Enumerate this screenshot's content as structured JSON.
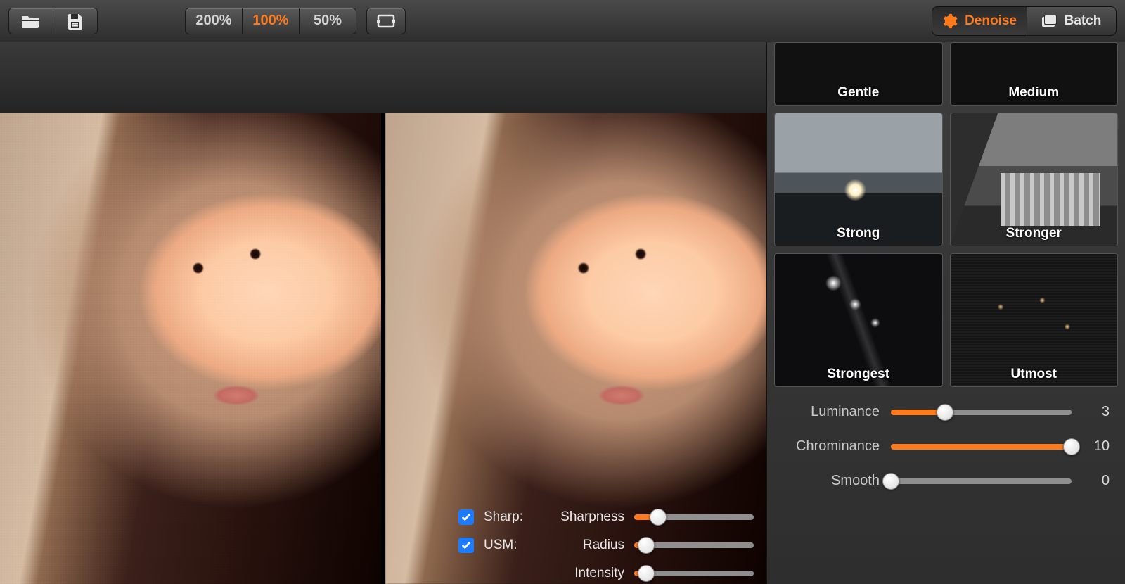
{
  "toolbar": {
    "zoom_options": [
      "200%",
      "100%",
      "50%"
    ],
    "zoom_active_index": 1
  },
  "modes": {
    "denoise_label": "Denoise",
    "batch_label": "Batch",
    "active": "denoise"
  },
  "presets": [
    {
      "label": "Gentle"
    },
    {
      "label": "Medium"
    },
    {
      "label": "Strong"
    },
    {
      "label": "Stronger"
    },
    {
      "label": "Strongest"
    },
    {
      "label": "Utmost"
    }
  ],
  "sliders": {
    "luminance": {
      "label": "Luminance",
      "value": 3,
      "min": 0,
      "max": 10
    },
    "chrominance": {
      "label": "Chrominance",
      "value": 10,
      "min": 0,
      "max": 10
    },
    "smooth": {
      "label": "Smooth",
      "value": 0,
      "min": 0,
      "max": 10
    }
  },
  "overlay": {
    "sharp": {
      "checked": true,
      "group_label": "Sharp:",
      "param_label": "Sharpness",
      "value": 2,
      "min": 0,
      "max": 10
    },
    "usm": {
      "checked": true,
      "group_label": "USM:",
      "radius": {
        "label": "Radius",
        "value": 1,
        "min": 0,
        "max": 10
      },
      "intensity": {
        "label": "Intensity",
        "value": 1,
        "min": 0,
        "max": 10
      }
    }
  }
}
